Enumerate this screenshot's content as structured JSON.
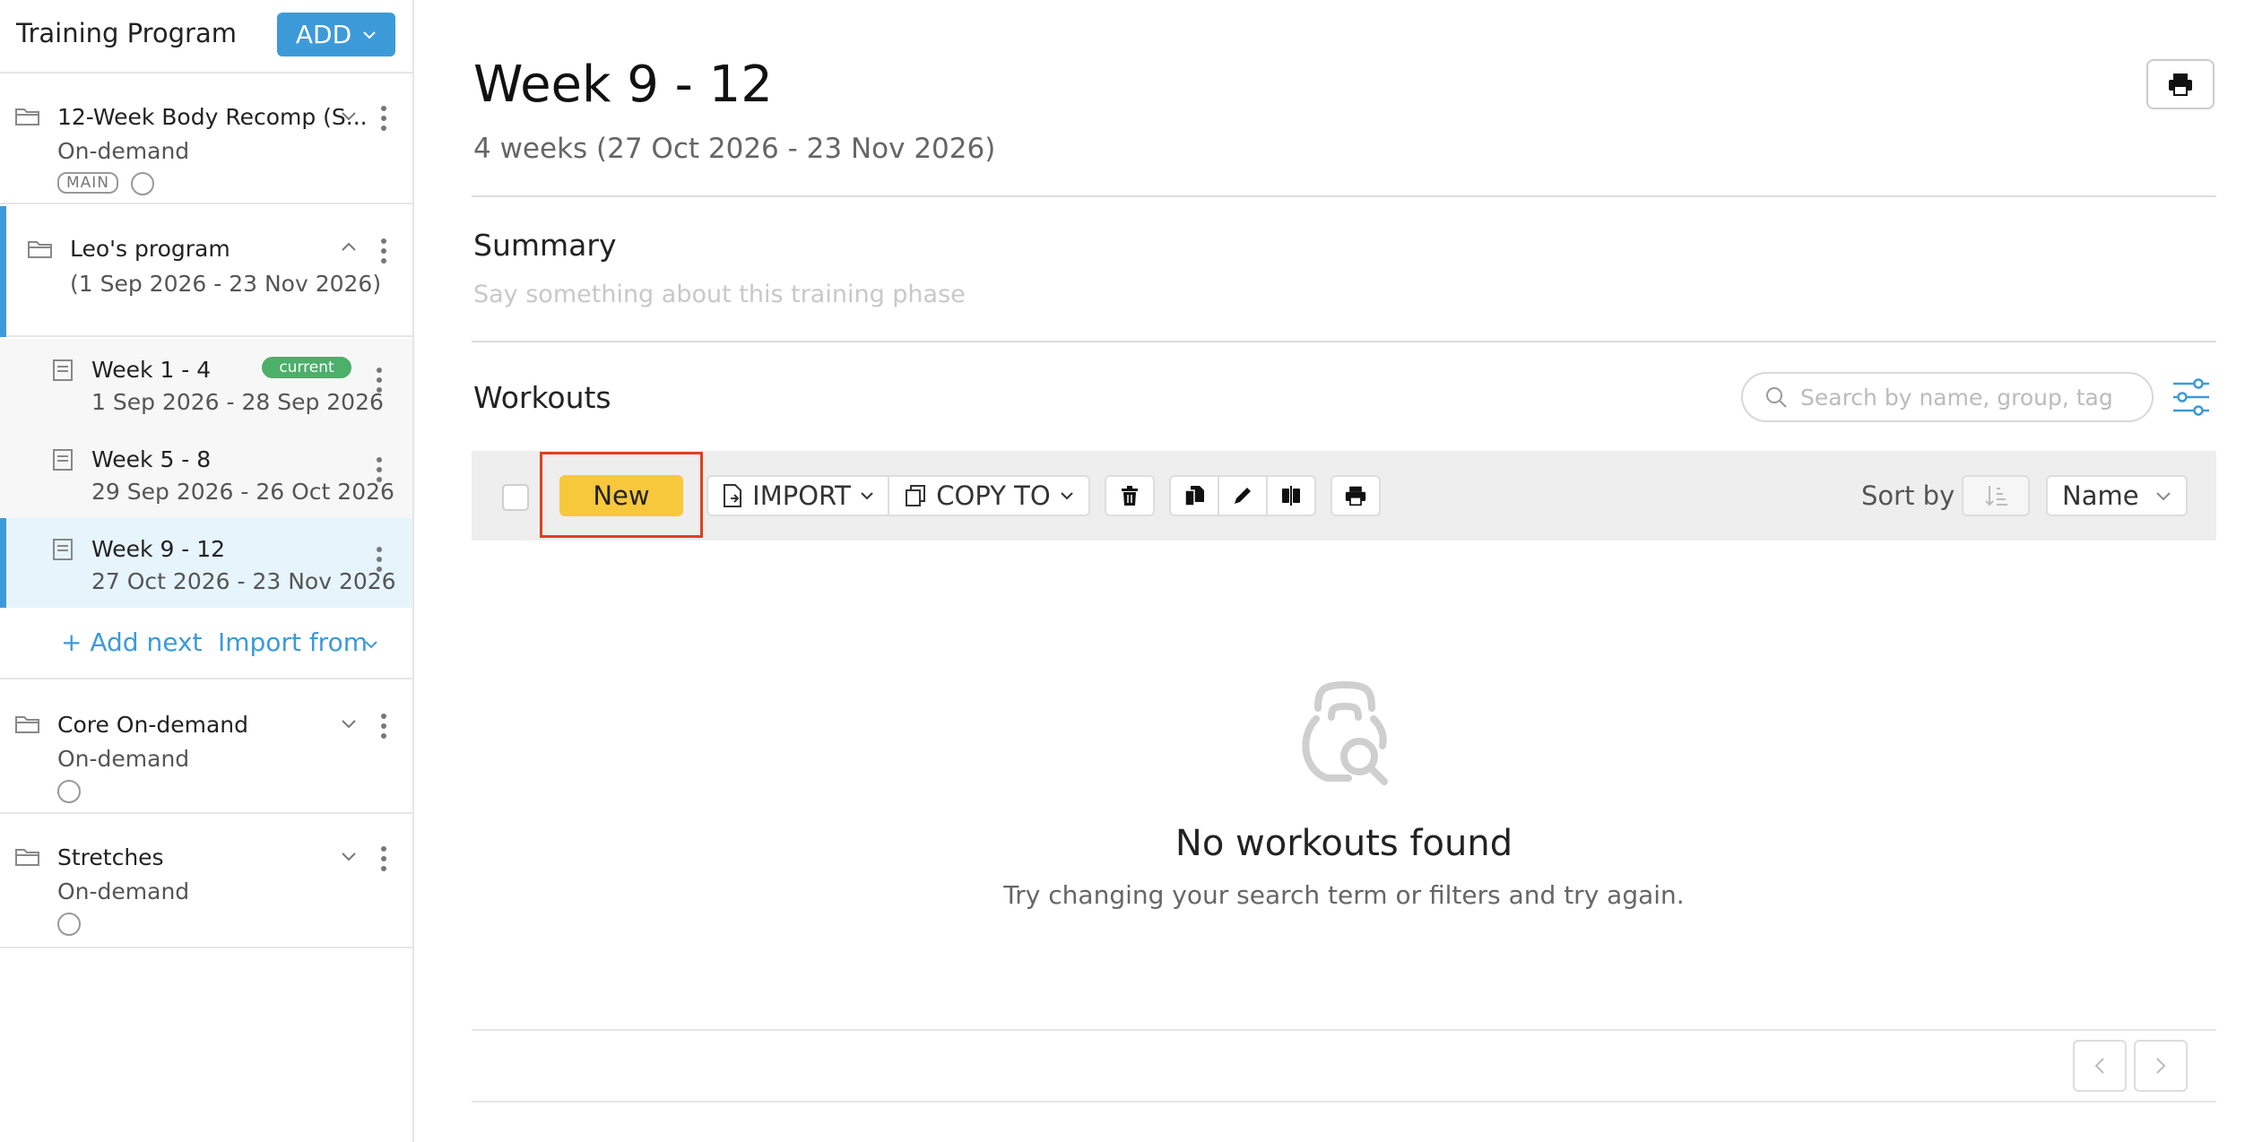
{
  "sidebar": {
    "title": "Training Program",
    "add_label": "ADD",
    "programs": [
      {
        "name": "12-Week Body Recomp (S...",
        "sub": "On-demand",
        "badge": "MAIN"
      },
      {
        "name": "Leo's program",
        "sub": "(1 Sep 2026 - 23 Nov 2026)"
      },
      {
        "name": "Core On-demand",
        "sub": "On-demand"
      },
      {
        "name": "Stretches",
        "sub": "On-demand"
      }
    ],
    "phases": [
      {
        "name": "Week 1 - 4",
        "dates": "1 Sep 2026 - 28 Sep 2026",
        "badge": "current"
      },
      {
        "name": "Week 5 - 8",
        "dates": "29 Sep 2026 - 26 Oct 2026"
      },
      {
        "name": "Week 9 - 12",
        "dates": "27 Oct 2026 - 23 Nov 2026"
      }
    ],
    "add_next": "+ Add next",
    "import_from": "Import from"
  },
  "main": {
    "title": "Week 9 - 12",
    "subtitle": "4 weeks (27 Oct 2026 - 23 Nov 2026)",
    "summary_label": "Summary",
    "summary_placeholder": "Say something about this training phase",
    "workouts_label": "Workouts",
    "search_placeholder": "Search by name, group, tag",
    "toolbar": {
      "new_label": "New",
      "import_label": "IMPORT",
      "copy_to_label": "COPY TO",
      "sort_by_label": "Sort by",
      "sort_value": "Name"
    },
    "empty": {
      "title": "No workouts found",
      "subtitle": "Try changing your search term or filters and try again."
    }
  },
  "colors": {
    "accent": "#3d9ad8",
    "new_button": "#f7c83c",
    "current_badge": "#4caf6a",
    "highlight": "#e0401f",
    "selected_row": "#e6f4fc"
  }
}
